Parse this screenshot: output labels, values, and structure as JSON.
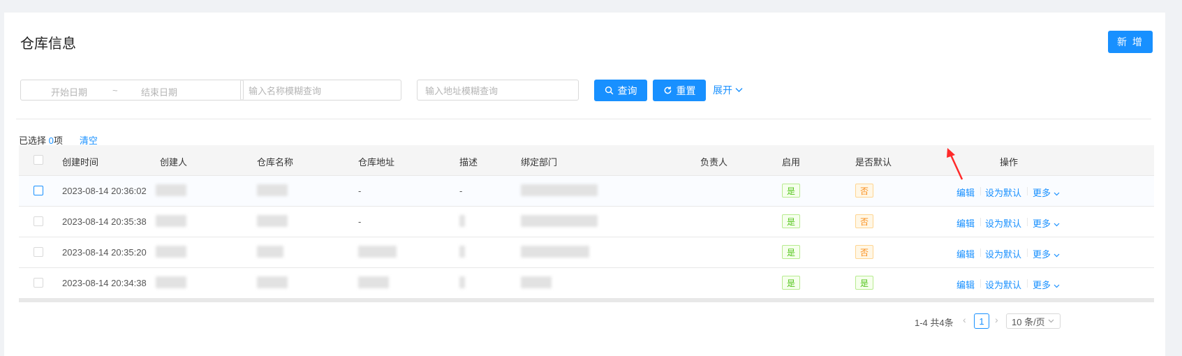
{
  "page": {
    "title": "仓库信息",
    "new_label": "新 增"
  },
  "filters": {
    "start_placeholder": "开始日期",
    "range_sep": "~",
    "end_placeholder": "结束日期",
    "name_placeholder": "输入名称模糊查询",
    "address_placeholder": "输入地址模糊查询",
    "search_label": "查询",
    "reset_label": "重置",
    "expand_label": "展开"
  },
  "selection": {
    "prefix": "已选择 ",
    "count": "0",
    "suffix": "项",
    "clear_label": "清空"
  },
  "columns": [
    "创建时间",
    "创建人",
    "仓库名称",
    "仓库地址",
    "描述",
    "绑定部门",
    "负责人",
    "启用",
    "是否默认",
    "操作"
  ],
  "rows": [
    {
      "created_at": "2023-08-14 20:36:02",
      "address": "-",
      "description": "-",
      "enabled": "是",
      "is_default": "否"
    },
    {
      "created_at": "2023-08-14 20:35:38",
      "address": "-",
      "description": "",
      "enabled": "是",
      "is_default": "否"
    },
    {
      "created_at": "2023-08-14 20:35:20",
      "address": "",
      "description": "",
      "enabled": "是",
      "is_default": "否"
    },
    {
      "created_at": "2023-08-14 20:34:38",
      "address": "",
      "description": "",
      "enabled": "是",
      "is_default": "是"
    }
  ],
  "row_actions": {
    "edit": "编辑",
    "set_default": "设为默认",
    "more": "更多"
  },
  "pagination": {
    "summary": "1-4 共4条",
    "current_page": "1",
    "page_size": "10 条/页"
  },
  "colors": {
    "primary": "#1890ff",
    "annotation": "#ff2a2a"
  }
}
